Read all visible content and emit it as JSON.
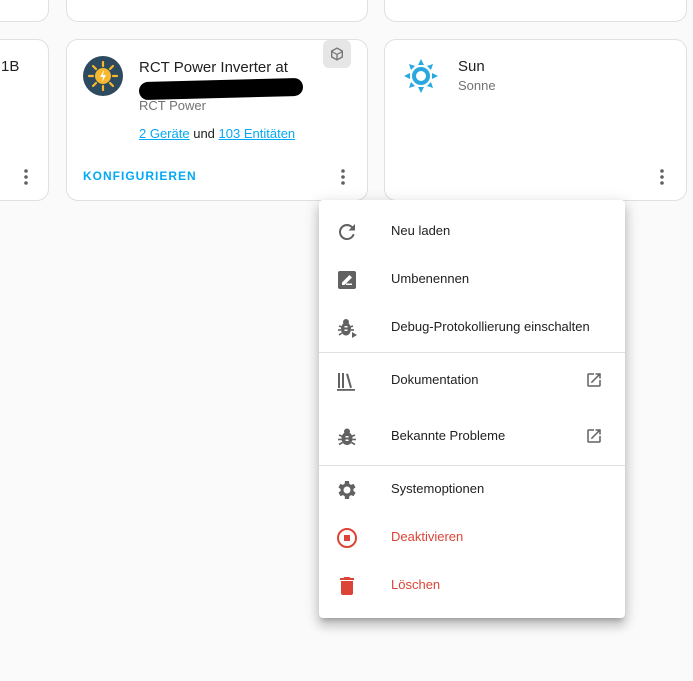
{
  "cards": {
    "left_partial": {
      "title_fragment": "1B"
    },
    "rct": {
      "title": "RCT Power Inverter at",
      "subtitle": "RCT Power",
      "devices_link": "2 Geräte",
      "and_text": "und",
      "entities_link": "103 Entitäten",
      "configure_label": "KONFIGURIEREN"
    },
    "sun": {
      "title": "Sun",
      "subtitle": "Sonne"
    }
  },
  "menu": {
    "reload": "Neu laden",
    "rename": "Umbenennen",
    "debug": "Debug-Protokollierung einschalten",
    "docs": "Dokumentation",
    "issues": "Bekannte Probleme",
    "system_options": "Systemoptionen",
    "disable": "Deaktivieren",
    "delete": "Löschen"
  },
  "colors": {
    "accent": "#03a9f4",
    "danger": "#db4437",
    "icon_grey": "#616161"
  }
}
